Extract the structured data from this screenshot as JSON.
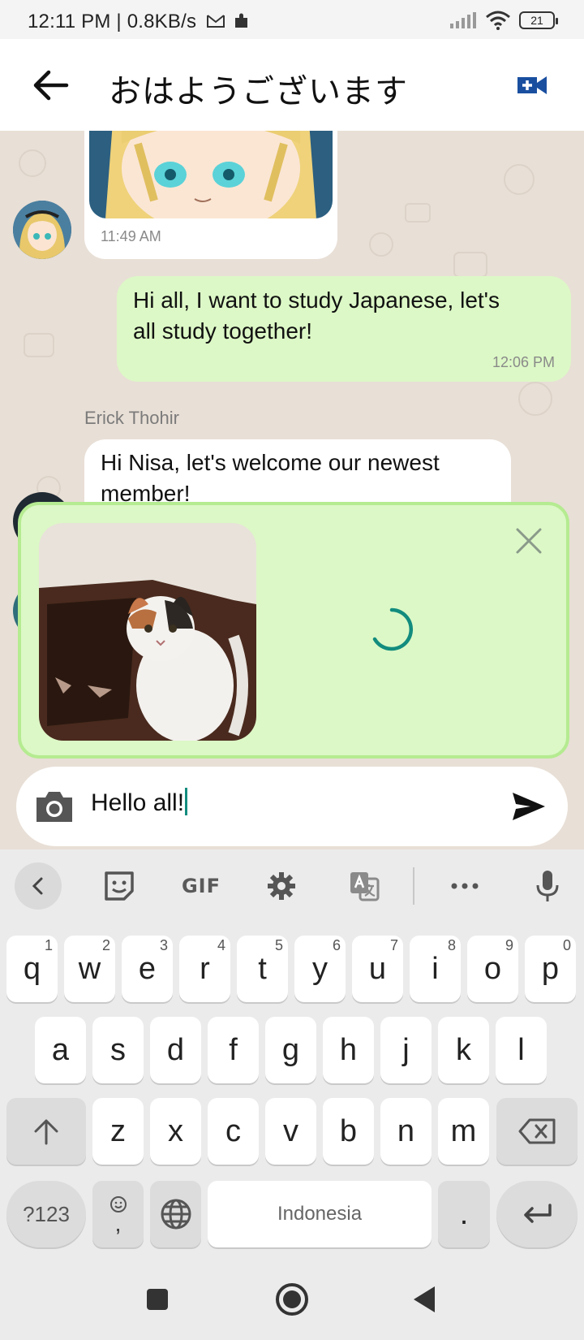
{
  "status_bar": {
    "time_speed": "12:11 PM | 0.8KB/s",
    "battery": "21"
  },
  "app_bar": {
    "title": "おはようございます"
  },
  "messages": [
    {
      "time": "11:49 AM"
    },
    {
      "text_line1": "Hi all, I want to study Japanese, let's",
      "text_line2": "all study together!",
      "time": "12:06 PM"
    },
    {
      "sender": "Erick Thohir",
      "text_line1": "Hi Nisa, let's welcome our newest",
      "text_line2": "member!"
    }
  ],
  "composer": {
    "text": "Hello all!"
  },
  "keyboard": {
    "toolbar": {
      "gif": "GIF"
    },
    "row1": [
      {
        "k": "q",
        "h": "1"
      },
      {
        "k": "w",
        "h": "2"
      },
      {
        "k": "e",
        "h": "3"
      },
      {
        "k": "r",
        "h": "4"
      },
      {
        "k": "t",
        "h": "5"
      },
      {
        "k": "y",
        "h": "6"
      },
      {
        "k": "u",
        "h": "7"
      },
      {
        "k": "i",
        "h": "8"
      },
      {
        "k": "o",
        "h": "9"
      },
      {
        "k": "p",
        "h": "0"
      }
    ],
    "row2": [
      "a",
      "s",
      "d",
      "f",
      "g",
      "h",
      "j",
      "k",
      "l"
    ],
    "row3": [
      "z",
      "x",
      "c",
      "v",
      "b",
      "n",
      "m"
    ],
    "row4": {
      "sym": "?123",
      "comma": ",",
      "space": "Indonesia",
      "period": "."
    }
  },
  "colors": {
    "accent": "#128c7e",
    "outgoing_bubble": "#dcf8c6",
    "video_icon": "#1a4fa0"
  }
}
